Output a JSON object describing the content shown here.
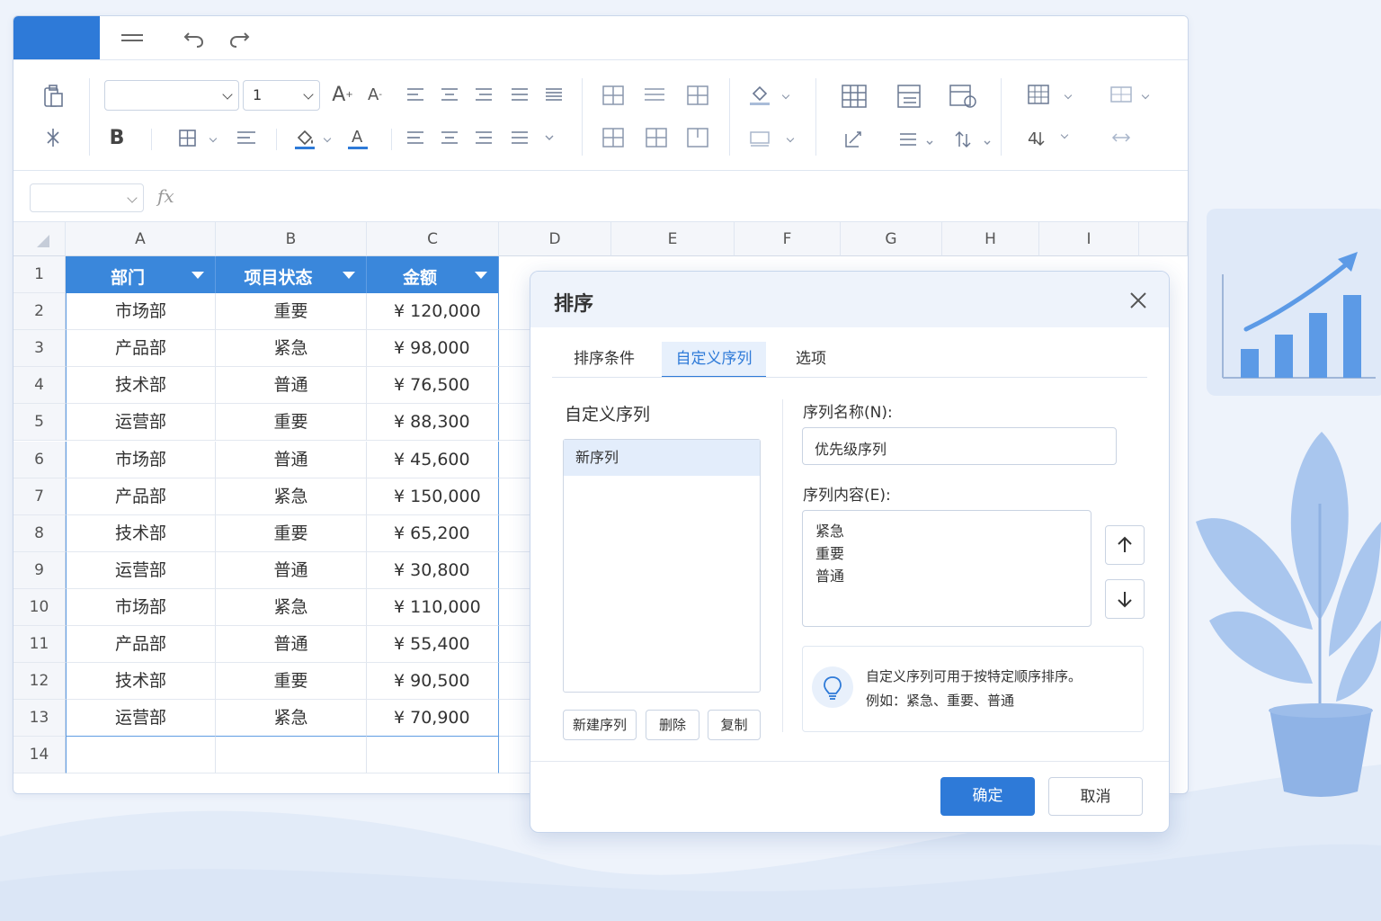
{
  "ribbon": {
    "font_size_value": "1",
    "bold_label": "B"
  },
  "formula_bar": {
    "fx_label": "fx"
  },
  "sheet": {
    "columns": [
      "A",
      "B",
      "C",
      "D",
      "E",
      "F",
      "G",
      "H",
      "I"
    ],
    "rows": [
      "1",
      "2",
      "3",
      "4",
      "5",
      "6",
      "7",
      "8",
      "9",
      "10",
      "11",
      "12",
      "13",
      "14"
    ],
    "header": {
      "a": "部门",
      "b": "项目状态",
      "c": "金额"
    },
    "data": [
      [
        "市场部",
        "重要",
        "¥ 120,000"
      ],
      [
        "产品部",
        "紧急",
        "¥ 98,000"
      ],
      [
        "技术部",
        "普通",
        "¥ 76,500"
      ],
      [
        "运营部",
        "重要",
        "¥ 88,300"
      ],
      [
        "市场部",
        "普通",
        "¥ 45,600"
      ],
      [
        "产品部",
        "紧急",
        "¥ 150,000"
      ],
      [
        "技术部",
        "重要",
        "¥ 65,200"
      ],
      [
        "运营部",
        "普通",
        "¥ 30,800"
      ],
      [
        "市场部",
        "紧急",
        "¥ 110,000"
      ],
      [
        "产品部",
        "普通",
        "¥ 55,400"
      ],
      [
        "技术部",
        "重要",
        "¥ 90,500"
      ],
      [
        "运营部",
        "紧急",
        "¥ 70,900"
      ]
    ]
  },
  "dialog": {
    "title": "排序",
    "tabs": [
      "排序条件",
      "自定义序列",
      "选项"
    ],
    "active_tab": "自定义序列",
    "list_title": "自定义序列",
    "list_items": [
      "新序列"
    ],
    "list_buttons": {
      "new": "新建序列",
      "delete": "删除",
      "copy": "复制"
    },
    "name_label": "序列名称(N):",
    "name_value": "优先级序列",
    "content_label": "序列内容(E):",
    "content_lines": [
      "紧急",
      "重要",
      "普通"
    ],
    "tip_line1": "自定义序列可用于按特定顺序排序。",
    "tip_line2": "例如：紧急、重要、普通",
    "ok_label": "确定",
    "cancel_label": "取消"
  },
  "colors": {
    "accent": "#2e7ad8",
    "header_fill": "#3a87db"
  }
}
